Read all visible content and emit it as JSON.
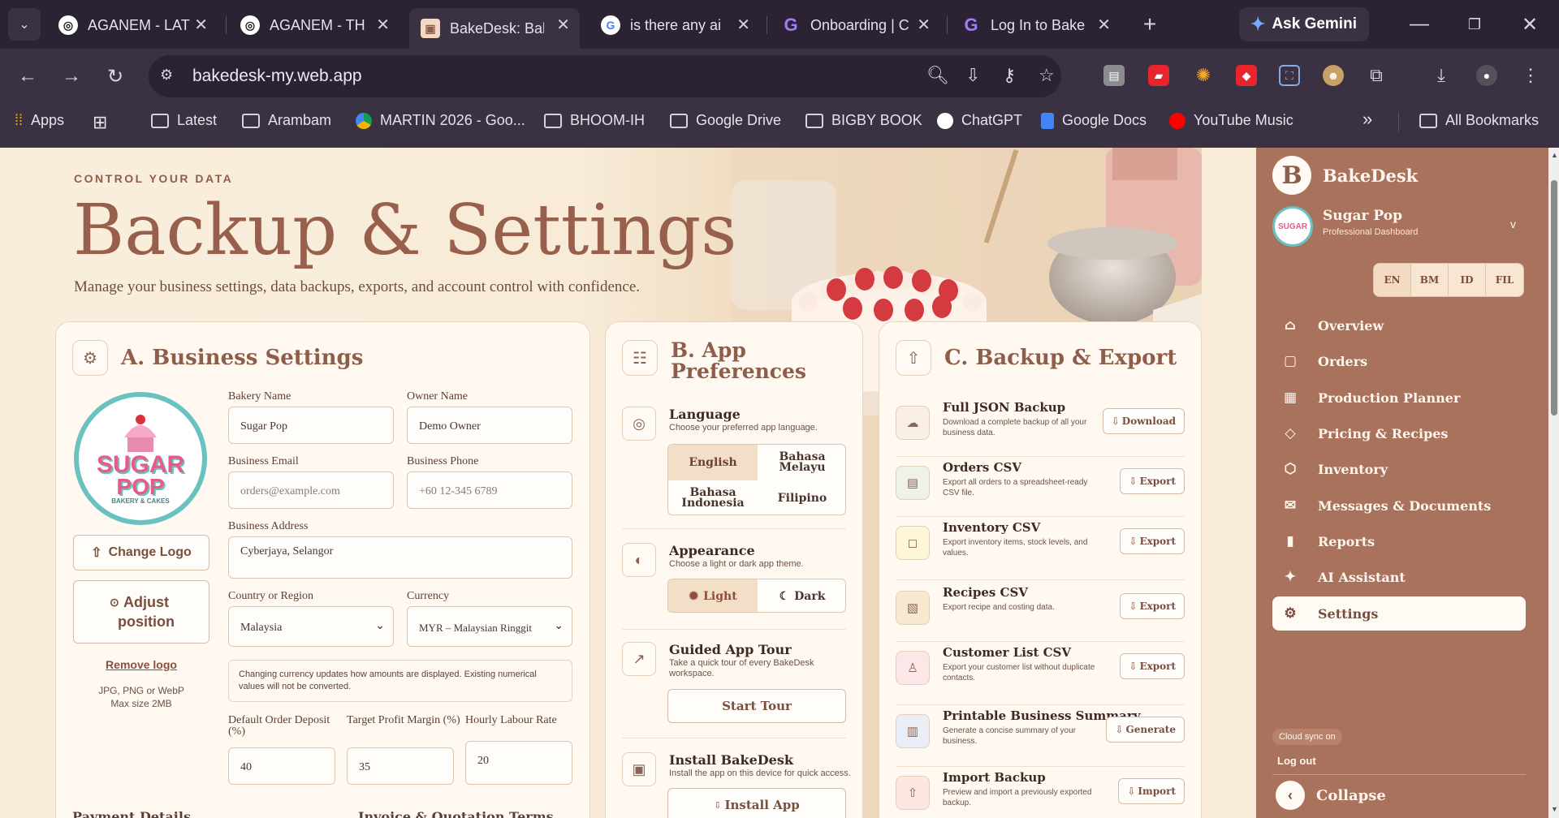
{
  "tabs": [
    {
      "label": "AGANEM - LAT",
      "icon": "chatgpt-icon"
    },
    {
      "label": "AGANEM - TH",
      "icon": "chatgpt-icon"
    },
    {
      "label": "BakeDesk: Bak",
      "icon": "bakedesk-icon"
    },
    {
      "label": "is there any ai",
      "icon": "google-icon"
    },
    {
      "label": "Onboarding | C",
      "icon": "onboarding-icon"
    },
    {
      "label": "Log In to Bake",
      "icon": "onboarding-icon"
    }
  ],
  "browser": {
    "gemini_label": "Ask Gemini",
    "url": "bakedesk-my.web.app"
  },
  "bookmarks": [
    {
      "label": "Apps"
    },
    {
      "label": "Latest"
    },
    {
      "label": "Arambam"
    },
    {
      "label": "MARTIN 2026 - Goo..."
    },
    {
      "label": "BHOOM-IH"
    },
    {
      "label": "Google Drive"
    },
    {
      "label": "BIGBY BOOK"
    },
    {
      "label": "ChatGPT"
    },
    {
      "label": "Google Docs"
    },
    {
      "label": "YouTube Music"
    }
  ],
  "all_bookmarks_label": "All Bookmarks",
  "header": {
    "eyebrow": "CONTROL YOUR DATA",
    "title": "Backup & Settings",
    "subtitle": "Manage your business settings, data backups, exports, and account control with confidence."
  },
  "business": {
    "title": "A. Business Settings",
    "bakery_name_label": "Bakery Name",
    "bakery_name": "Sugar Pop",
    "owner_name_label": "Owner Name",
    "owner_name": "Demo Owner",
    "email_label": "Business Email",
    "email_placeholder": "orders@example.com",
    "phone_label": "Business Phone",
    "phone_placeholder": "+60 12-345 6789",
    "address_label": "Business Address",
    "address": "Cyberjaya, Selangor",
    "country_label": "Country or Region",
    "country": "Malaysia",
    "currency_label": "Currency",
    "currency": "MYR – Malaysian Ringgit",
    "currency_note": "Changing currency updates how amounts are displayed. Existing numerical values will not be converted.",
    "deposit_label": "Default Order Deposit (%)",
    "deposit": "40",
    "margin_label": "Target Profit Margin (%)",
    "margin": "35",
    "labour_label": "Hourly Labour Rate",
    "labour": "20",
    "change_logo": "Change Logo",
    "adjust_position": "Adjust position",
    "remove_logo": "Remove logo",
    "logo_hint_1": "JPG, PNG or WebP",
    "logo_hint_2": "Max size 2MB",
    "logo_text_1": "SUGAR",
    "logo_text_2": "POP",
    "logo_text_3": "BAKERY & CAKES",
    "payment_details": "Payment Details",
    "invoice_terms": "Invoice & Quotation Terms"
  },
  "prefs": {
    "title_1": "B. App",
    "title_2": "Preferences",
    "language_title": "Language",
    "language_desc": "Choose your preferred app language.",
    "languages": [
      "English",
      "Bahasa Melayu",
      "Bahasa Indonesia",
      "Filipino"
    ],
    "appearance_title": "Appearance",
    "appearance_desc": "Choose a light or dark app theme.",
    "light": "Light",
    "dark": "Dark",
    "tour_title": "Guided App Tour",
    "tour_desc": "Take a quick tour of every BakeDesk workspace.",
    "tour_button": "Start Tour",
    "install_title": "Install BakeDesk",
    "install_desc": "Install the app on this device for quick access.",
    "install_button": "Install App"
  },
  "backup": {
    "title": "C. Backup & Export",
    "rows": [
      {
        "title": "Full JSON Backup",
        "desc": "Download a complete backup of all your business data.",
        "button": "Download"
      },
      {
        "title": "Orders CSV",
        "desc": "Export all orders to a spreadsheet-ready CSV file.",
        "button": "Export"
      },
      {
        "title": "Inventory CSV",
        "desc": "Export inventory items, stock levels, and values.",
        "button": "Export"
      },
      {
        "title": "Recipes CSV",
        "desc": "Export recipe and costing data.",
        "button": "Export"
      },
      {
        "title": "Customer List CSV",
        "desc": "Export your customer list without duplicate contacts.",
        "button": "Export"
      },
      {
        "title": "Printable Business Summary",
        "desc": "Generate a concise summary of your business.",
        "button": "Generate"
      },
      {
        "title": "Import Backup",
        "desc": "Preview and import a previously exported backup.",
        "button": "Import"
      }
    ]
  },
  "sidebar": {
    "brand_letter": "B",
    "brand": "BakeDesk",
    "business_name": "Sugar Pop",
    "business_sub": "Professional Dashboard",
    "langs": [
      "EN",
      "BM",
      "ID",
      "FIL"
    ],
    "items": [
      {
        "label": "Overview"
      },
      {
        "label": "Orders"
      },
      {
        "label": "Production Planner"
      },
      {
        "label": "Pricing & Recipes"
      },
      {
        "label": "Inventory"
      },
      {
        "label": "Messages & Documents"
      },
      {
        "label": "Reports"
      },
      {
        "label": "AI Assistant"
      },
      {
        "label": "Settings"
      }
    ],
    "cloud_sync": "Cloud sync on",
    "logout": "Log out",
    "collapse": "Collapse"
  },
  "colors": {
    "accent": "#98604c",
    "sidebar": "#a9725c",
    "background": "#f8ecd8"
  }
}
